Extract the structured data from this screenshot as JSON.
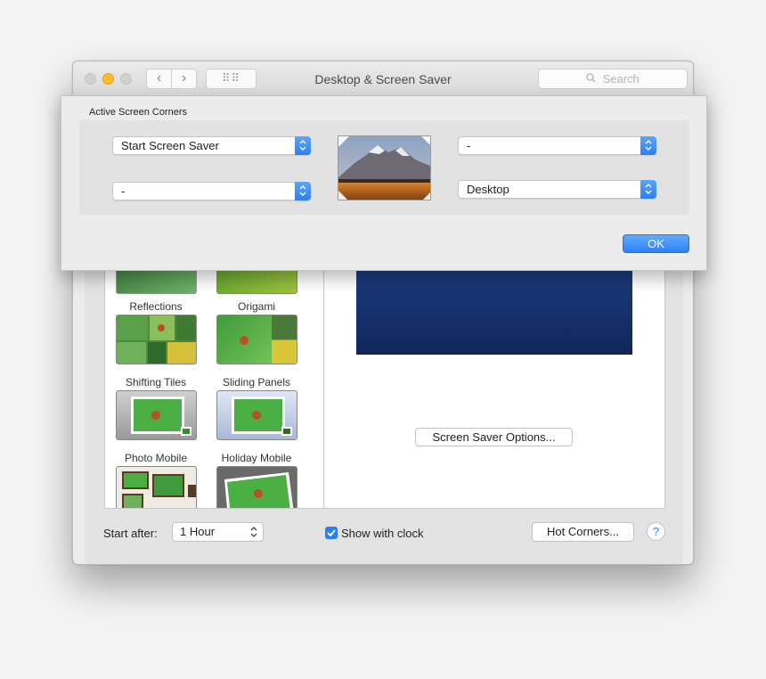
{
  "window": {
    "title": "Desktop & Screen Saver",
    "search_placeholder": "Search",
    "nav_back": "‹",
    "nav_forward": "›",
    "grid_glyph": "⠿⠿"
  },
  "screen_savers": [
    {
      "label": "Reflections",
      "thumb": "green-panels"
    },
    {
      "label": "Origami",
      "thumb": "green-fold"
    },
    {
      "label": "Shifting Tiles",
      "thumb": "tiles"
    },
    {
      "label": "Sliding Panels",
      "thumb": "panels"
    },
    {
      "label": "Photo Mobile",
      "thumb": "mobile-grey"
    },
    {
      "label": "Holiday Mobile",
      "thumb": "mobile-blue"
    },
    {
      "label": "",
      "thumb": "frames"
    },
    {
      "label": "",
      "thumb": "tilted"
    }
  ],
  "preview": {
    "options_button": "Screen Saver Options..."
  },
  "bottom_bar": {
    "start_after_label": "Start after:",
    "start_after_value": "1 Hour",
    "show_clock_label": "Show with clock",
    "show_clock_checked": true,
    "hot_corners_button": "Hot Corners...",
    "help_button": "?"
  },
  "sheet": {
    "title": "Active Screen Corners",
    "top_left": "Start Screen Saver",
    "top_right": "-",
    "bottom_left": "-",
    "bottom_right": "Desktop",
    "ok_button": "OK"
  },
  "colors": {
    "accent": "#2d7df6",
    "traffic_minimize": "#fdbb2e",
    "preview_blue": "#15306a"
  },
  "icons": {
    "magnifier": "⌕",
    "updown": "⌃⌄",
    "check": "✓"
  }
}
